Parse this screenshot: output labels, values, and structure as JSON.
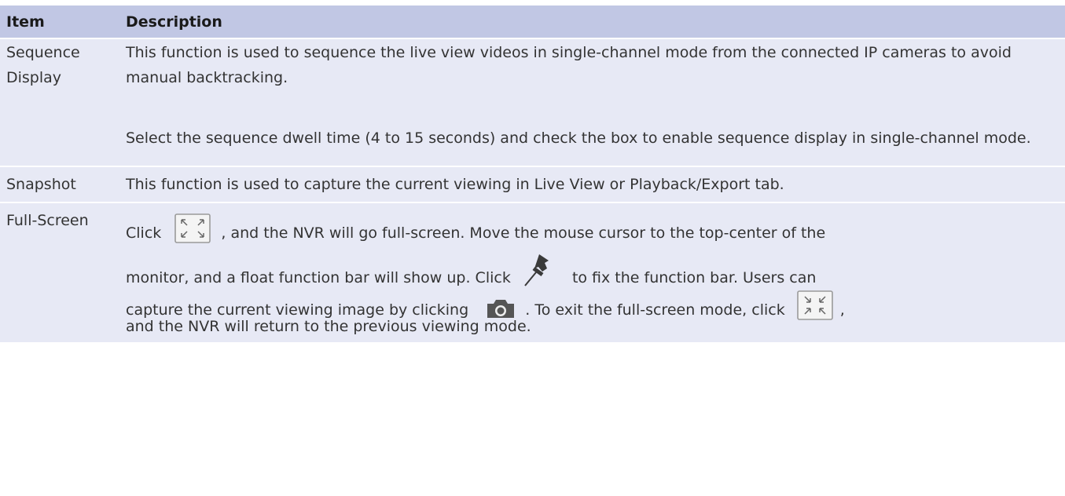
{
  "header": {
    "item": "Item",
    "description": "Description"
  },
  "rows": [
    {
      "item": "Sequence Display",
      "desc_p1": "This function is used to sequence the live view videos in single-channel mode from the con­nected IP cameras to avoid manual backtracking.",
      "desc_p2": "Select the sequence dwell time (4 to 15 seconds) and check the box to enable sequence display in single-channel mode."
    },
    {
      "item": "Snapshot",
      "desc": "This function is used to capture the current viewing in Live View or Playback/Export tab."
    },
    {
      "item": "Full-Screen",
      "line1_a": "Click",
      "line1_b": ", and the NVR will go full-screen. Move the mouse cursor to the top-center of the",
      "line2_a": "monitor, and a float function bar will show up. Click",
      "line2_b": "to fix the function bar. Users can",
      "line3_a": "capture the current viewing image by clicking",
      "line3_b": ". To exit the full-screen mode, click",
      "line3_c": ",",
      "line4": "and the NVR will return to the previous viewing mode."
    }
  ],
  "icons": {
    "fullscreen": "fullscreen-icon",
    "pin": "pin-icon",
    "camera": "camera-icon",
    "exit_fullscreen": "exit-fullscreen-icon"
  }
}
